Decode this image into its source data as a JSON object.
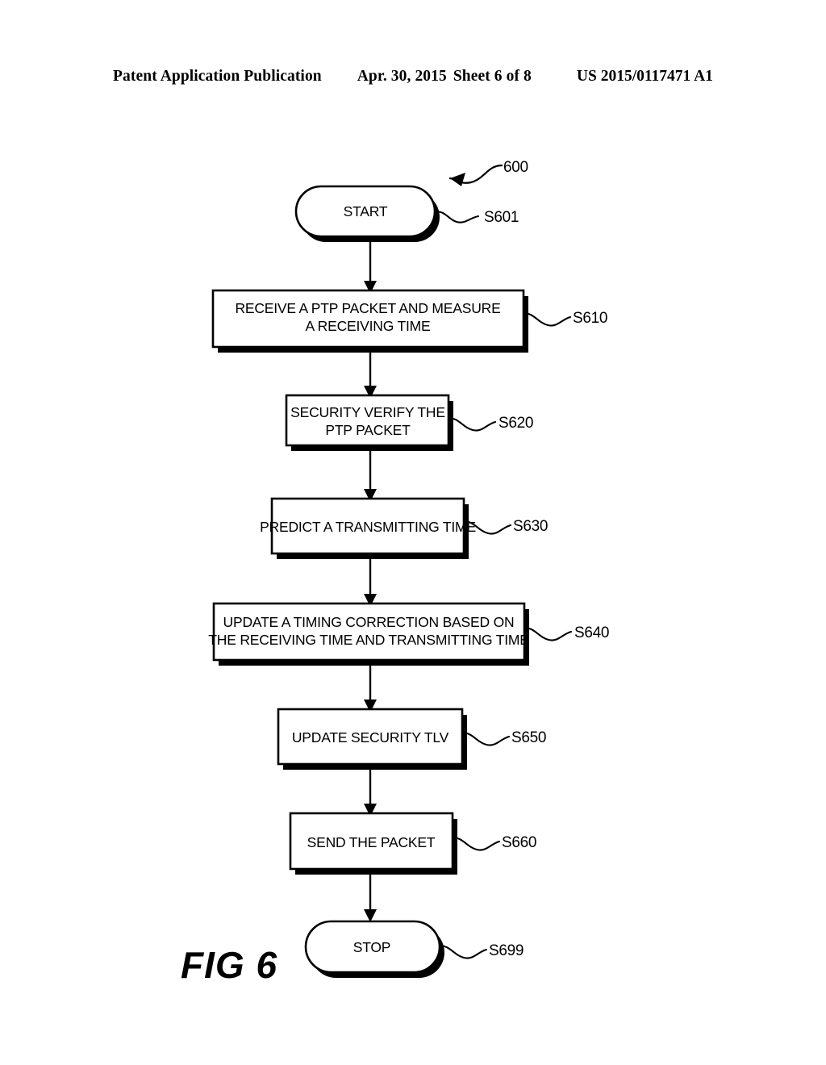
{
  "header": {
    "publication": "Patent Application Publication",
    "date": "Apr. 30, 2015",
    "sheet": "Sheet 6 of 8",
    "patent_number": "US 2015/0117471 A1"
  },
  "figure": {
    "caption": "FIG 6",
    "diagram_reference": "600"
  },
  "flowchart": {
    "nodes": [
      {
        "id": "start",
        "type": "terminator",
        "lines": [
          "START"
        ],
        "ref": "S601"
      },
      {
        "id": "s610",
        "type": "process",
        "lines": [
          "RECEIVE A PTP PACKET AND MEASURE",
          "A RECEIVING TIME"
        ],
        "ref": "S610"
      },
      {
        "id": "s620",
        "type": "process",
        "lines": [
          "SECURITY VERIFY THE",
          "PTP PACKET"
        ],
        "ref": "S620"
      },
      {
        "id": "s630",
        "type": "process",
        "lines": [
          "PREDICT A TRANSMITTING TIME"
        ],
        "ref": "S630"
      },
      {
        "id": "s640",
        "type": "process",
        "lines": [
          "UPDATE A TIMING CORRECTION BASED ON",
          "THE RECEIVING TIME AND TRANSMITTING TIME"
        ],
        "ref": "S640"
      },
      {
        "id": "s650",
        "type": "process",
        "lines": [
          "UPDATE SECURITY TLV"
        ],
        "ref": "S650"
      },
      {
        "id": "s660",
        "type": "process",
        "lines": [
          "SEND THE PACKET"
        ],
        "ref": "S660"
      },
      {
        "id": "stop",
        "type": "terminator",
        "lines": [
          "STOP"
        ],
        "ref": "S699"
      }
    ]
  },
  "colors": {
    "ink": "#000000",
    "page": "#ffffff"
  }
}
